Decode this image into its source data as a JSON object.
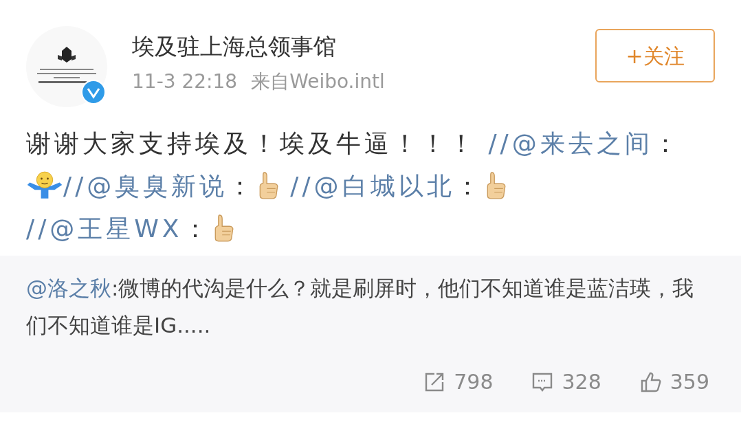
{
  "author": {
    "name": "埃及驻上海总领事馆",
    "verified": true,
    "time": "11-3 22:18",
    "source": "来自Weibo.intl"
  },
  "follow_button": {
    "label": "+关注"
  },
  "post": {
    "segments": [
      {
        "kind": "text",
        "text": "谢谢大家支持埃及！埃及牛逼！！！ "
      },
      {
        "kind": "mention",
        "text": "//@来去之间"
      },
      {
        "kind": "text",
        "text": "："
      },
      {
        "kind": "shrug"
      },
      {
        "kind": "mention",
        "text": "//@臭臭新说"
      },
      {
        "kind": "text",
        "text": "："
      },
      {
        "kind": "thumb"
      },
      {
        "kind": "mention",
        "text": "//@白城以北"
      },
      {
        "kind": "text",
        "text": "："
      },
      {
        "kind": "thumb"
      },
      {
        "kind": "mention",
        "text": "//@王星WX"
      },
      {
        "kind": "text",
        "text": "："
      },
      {
        "kind": "thumb"
      }
    ]
  },
  "repost": {
    "mention": "@洛之秋",
    "text": ":微博的代沟是什么？就是刷屏时，他们不知道谁是蓝洁瑛，我们不知道谁是IG....."
  },
  "stats": [
    {
      "kind": "share",
      "count": "798"
    },
    {
      "kind": "comment",
      "count": "328"
    },
    {
      "kind": "like",
      "count": "359"
    }
  ]
}
